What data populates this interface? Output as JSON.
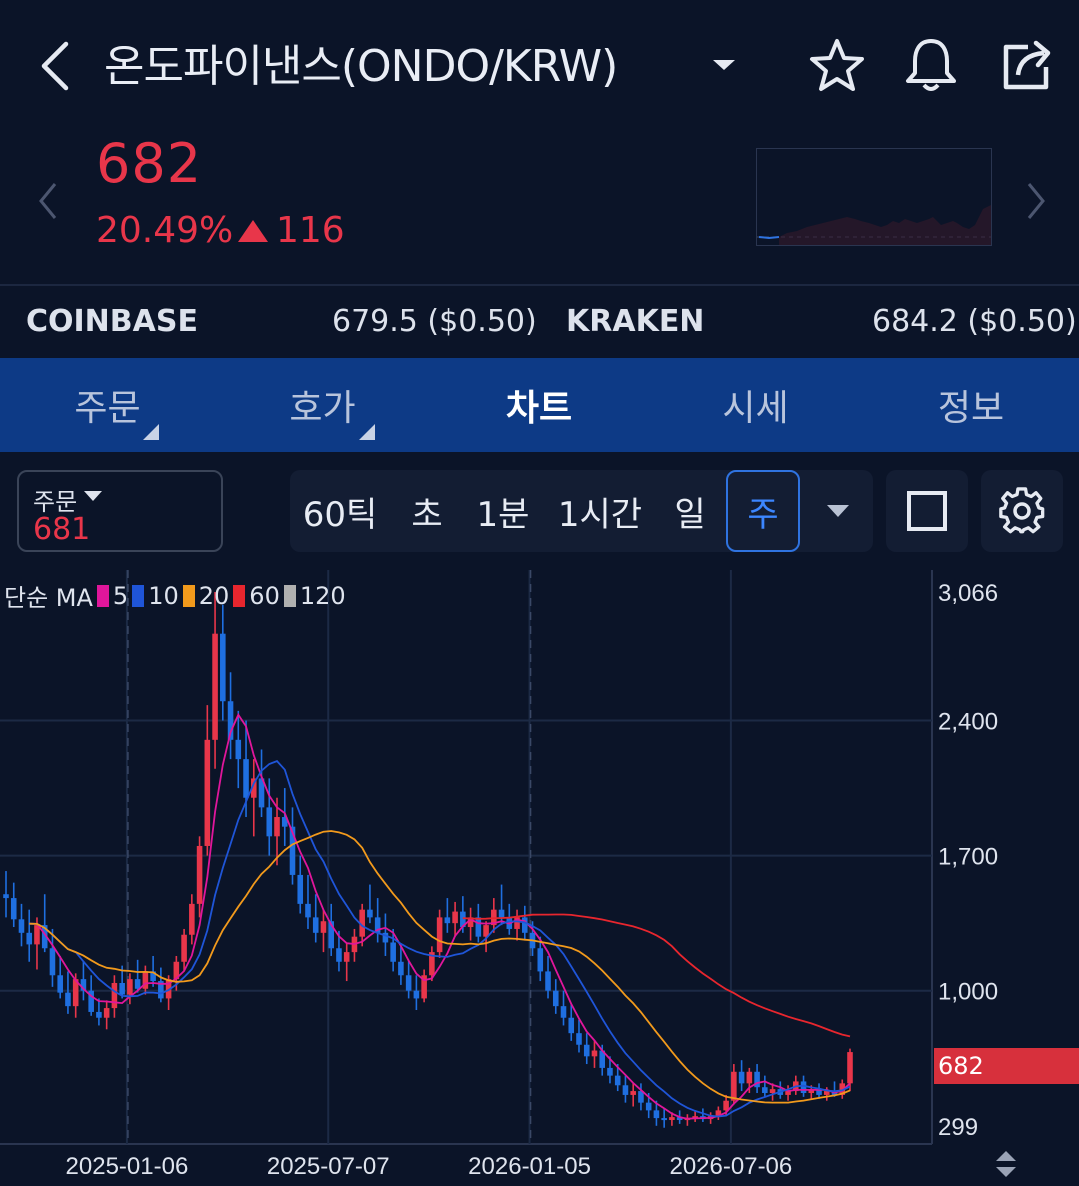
{
  "header": {
    "title": "온도파이낸스(ONDO/KRW)",
    "icons": [
      "back-arrow-icon",
      "dropdown-caret-icon",
      "star-icon",
      "bell-icon",
      "share-icon"
    ]
  },
  "ticker": {
    "price": "682",
    "change_percent": "20.49%",
    "change_amount": "116",
    "direction": "up",
    "color_up": "#e8364a"
  },
  "exchanges": [
    {
      "name": "COINBASE",
      "value": "679.5 ($0.50)"
    },
    {
      "name": "KRAKEN",
      "value": "684.2 ($0.50)"
    }
  ],
  "tabs": [
    {
      "label": "주문",
      "has_menu": true
    },
    {
      "label": "호가",
      "has_menu": true
    },
    {
      "label": "차트",
      "active": true
    },
    {
      "label": "시세"
    },
    {
      "label": "정보"
    }
  ],
  "toolbar": {
    "order_label": "주문",
    "order_value": "681",
    "periods": [
      "60틱",
      "초",
      "1분",
      "1시간",
      "일",
      "주"
    ],
    "selected_period": "주",
    "accent": "#2f73e0"
  },
  "chart_data": {
    "type": "candlestick",
    "interval": "weekly",
    "legend_label": "단순 MA",
    "ma_legend": [
      {
        "period": "5",
        "color": "#e0169b"
      },
      {
        "period": "10",
        "color": "#1f55d8"
      },
      {
        "period": "20",
        "color": "#f29a1c"
      },
      {
        "period": "60",
        "color": "#e8262e"
      },
      {
        "period": "120",
        "color": "#b0b0b0"
      }
    ],
    "y_ticks": [
      "3,066",
      "2,400",
      "1,700",
      "1,000",
      "299"
    ],
    "y_tick_values": [
      3066,
      2400,
      1700,
      1000,
      299
    ],
    "x_ticks": [
      "2025-01-06",
      "2025-07-07",
      "2026-01-05",
      "2026-07-06"
    ],
    "current_price_label": "682",
    "up_color": "#e8364a",
    "down_color": "#1f6fe0",
    "candles_ohlc": [
      [
        1500,
        1620,
        1380,
        1480
      ],
      [
        1480,
        1560,
        1330,
        1370
      ],
      [
        1370,
        1450,
        1230,
        1300
      ],
      [
        1300,
        1420,
        1150,
        1240
      ],
      [
        1240,
        1380,
        1110,
        1340
      ],
      [
        1340,
        1500,
        1200,
        1220
      ],
      [
        1220,
        1320,
        1020,
        1080
      ],
      [
        1080,
        1180,
        960,
        990
      ],
      [
        990,
        1100,
        880,
        920
      ],
      [
        920,
        1090,
        860,
        1060
      ],
      [
        1060,
        1150,
        950,
        1000
      ],
      [
        1000,
        1080,
        870,
        890
      ],
      [
        890,
        960,
        820,
        860
      ],
      [
        860,
        950,
        800,
        910
      ],
      [
        910,
        1080,
        860,
        1040
      ],
      [
        1040,
        1130,
        960,
        980
      ],
      [
        980,
        1090,
        930,
        1060
      ],
      [
        1060,
        1160,
        990,
        1010
      ],
      [
        1010,
        1130,
        980,
        1100
      ],
      [
        1100,
        1180,
        1020,
        1050
      ],
      [
        1050,
        1120,
        940,
        960
      ],
      [
        960,
        1080,
        900,
        1060
      ],
      [
        1060,
        1180,
        1000,
        1150
      ],
      [
        1150,
        1320,
        1100,
        1290
      ],
      [
        1290,
        1500,
        1240,
        1450
      ],
      [
        1450,
        1800,
        1380,
        1750
      ],
      [
        1750,
        2480,
        1700,
        2300
      ],
      [
        2300,
        3066,
        2150,
        2850
      ],
      [
        2850,
        3000,
        2400,
        2500
      ],
      [
        2500,
        2650,
        2200,
        2300
      ],
      [
        2300,
        2450,
        2050,
        2200
      ],
      [
        2200,
        2400,
        1900,
        2000
      ],
      [
        2000,
        2200,
        1800,
        2100
      ],
      [
        2100,
        2250,
        1900,
        1950
      ],
      [
        1950,
        2100,
        1700,
        1800
      ],
      [
        1800,
        2000,
        1650,
        1900
      ],
      [
        1900,
        2050,
        1750,
        1850
      ],
      [
        1850,
        1950,
        1550,
        1600
      ],
      [
        1600,
        1700,
        1400,
        1450
      ],
      [
        1450,
        1600,
        1320,
        1380
      ],
      [
        1380,
        1500,
        1250,
        1300
      ],
      [
        1300,
        1420,
        1200,
        1360
      ],
      [
        1360,
        1450,
        1180,
        1220
      ],
      [
        1220,
        1310,
        1100,
        1150
      ],
      [
        1150,
        1250,
        1050,
        1200
      ],
      [
        1200,
        1320,
        1150,
        1280
      ],
      [
        1280,
        1450,
        1230,
        1420
      ],
      [
        1420,
        1550,
        1350,
        1380
      ],
      [
        1380,
        1480,
        1250,
        1300
      ],
      [
        1300,
        1400,
        1180,
        1250
      ],
      [
        1250,
        1320,
        1100,
        1150
      ],
      [
        1150,
        1230,
        1030,
        1080
      ],
      [
        1080,
        1160,
        960,
        1000
      ],
      [
        1000,
        1080,
        900,
        960
      ],
      [
        960,
        1110,
        940,
        1080
      ],
      [
        1080,
        1230,
        1050,
        1200
      ],
      [
        1200,
        1420,
        1170,
        1380
      ],
      [
        1380,
        1480,
        1300,
        1350
      ],
      [
        1350,
        1460,
        1280,
        1410
      ],
      [
        1410,
        1490,
        1300,
        1330
      ],
      [
        1330,
        1430,
        1260,
        1380
      ],
      [
        1380,
        1450,
        1250,
        1280
      ],
      [
        1280,
        1360,
        1200,
        1340
      ],
      [
        1340,
        1480,
        1300,
        1420
      ],
      [
        1420,
        1550,
        1340,
        1380
      ],
      [
        1380,
        1450,
        1290,
        1320
      ],
      [
        1320,
        1420,
        1260,
        1380
      ],
      [
        1380,
        1440,
        1260,
        1300
      ],
      [
        1300,
        1360,
        1180,
        1220
      ],
      [
        1220,
        1280,
        1050,
        1100
      ],
      [
        1100,
        1180,
        960,
        1000
      ],
      [
        1000,
        1060,
        880,
        920
      ],
      [
        920,
        1000,
        820,
        860
      ],
      [
        860,
        930,
        740,
        780
      ],
      [
        780,
        850,
        680,
        720
      ],
      [
        720,
        780,
        620,
        660
      ],
      [
        660,
        740,
        600,
        690
      ],
      [
        690,
        720,
        560,
        600
      ],
      [
        600,
        660,
        520,
        560
      ],
      [
        560,
        620,
        480,
        510
      ],
      [
        510,
        560,
        420,
        460
      ],
      [
        460,
        520,
        400,
        480
      ],
      [
        480,
        520,
        380,
        420
      ],
      [
        420,
        470,
        340,
        380
      ],
      [
        380,
        430,
        300,
        340
      ],
      [
        340,
        390,
        290,
        330
      ],
      [
        330,
        370,
        300,
        345
      ],
      [
        345,
        380,
        310,
        330
      ],
      [
        330,
        360,
        300,
        340
      ],
      [
        340,
        380,
        320,
        350
      ],
      [
        350,
        390,
        320,
        335
      ],
      [
        335,
        370,
        310,
        350
      ],
      [
        350,
        400,
        330,
        380
      ],
      [
        380,
        460,
        350,
        430
      ],
      [
        430,
        620,
        410,
        580
      ],
      [
        580,
        640,
        480,
        520
      ],
      [
        520,
        600,
        470,
        580
      ],
      [
        580,
        620,
        470,
        500
      ],
      [
        500,
        560,
        450,
        470
      ],
      [
        470,
        520,
        430,
        490
      ],
      [
        490,
        530,
        440,
        460
      ],
      [
        460,
        510,
        430,
        480
      ],
      [
        480,
        560,
        460,
        530
      ],
      [
        530,
        560,
        450,
        470
      ],
      [
        470,
        510,
        440,
        490
      ],
      [
        490,
        520,
        440,
        460
      ],
      [
        460,
        500,
        430,
        480
      ],
      [
        480,
        530,
        450,
        460
      ],
      [
        460,
        540,
        440,
        520
      ],
      [
        520,
        700,
        480,
        682
      ]
    ]
  }
}
